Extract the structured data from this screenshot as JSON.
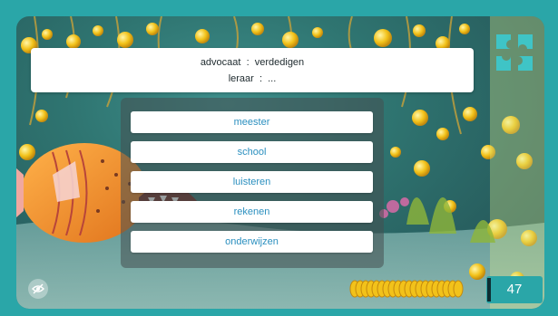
{
  "question": {
    "line1": "advocaat  :  verdedigen",
    "line2": "leraar  :  ..."
  },
  "options": [
    "meester",
    "school",
    "luisteren",
    "rekenen",
    "onderwijzen"
  ],
  "score": "47",
  "timer_remaining": 0.9,
  "colors": {
    "frame": "#2aa6a8",
    "option_text": "#2a8fbf",
    "coin": "#f2c21a"
  },
  "icons": {
    "logo": "puzzle-logo-icon",
    "hide": "eye-off-icon"
  }
}
